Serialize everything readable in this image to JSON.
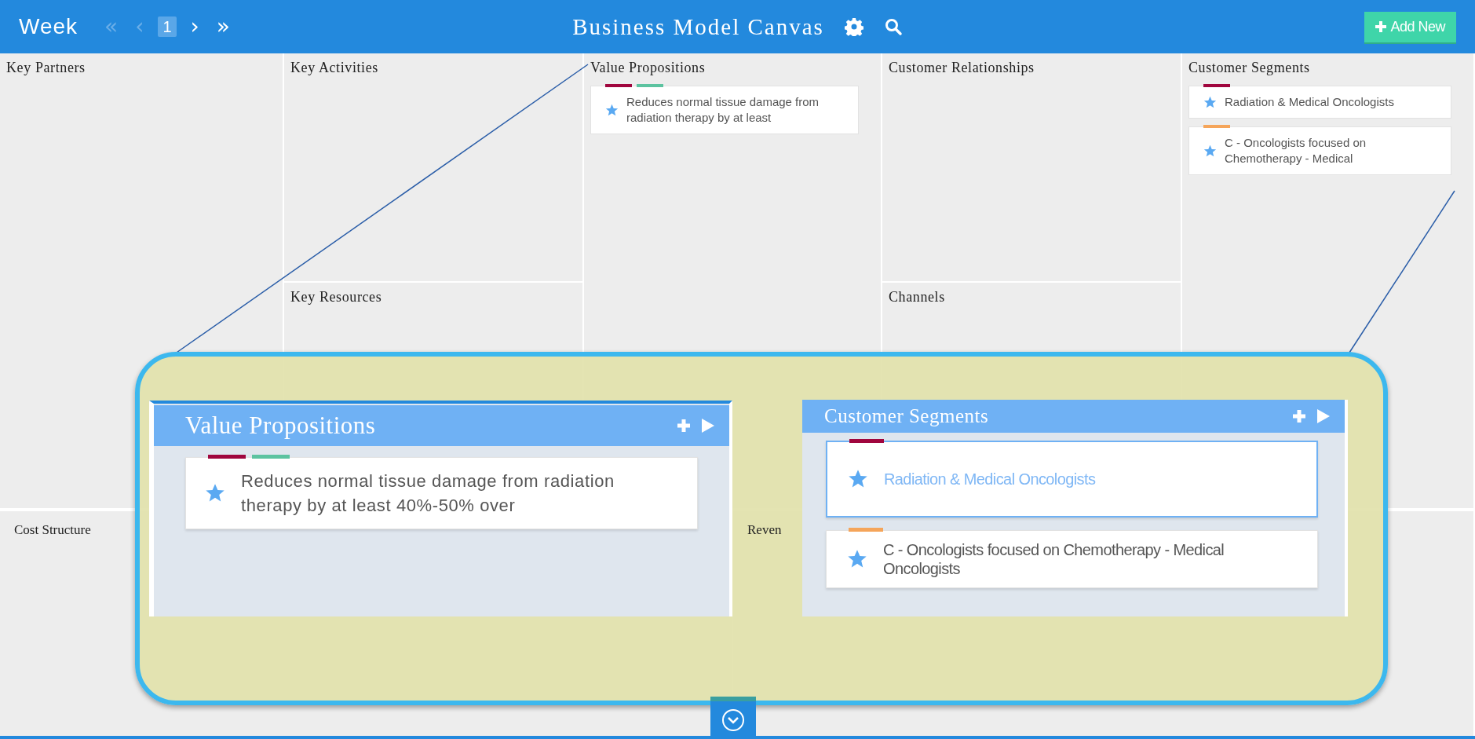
{
  "header": {
    "period_label": "Week",
    "pager": [
      {
        "label": "«",
        "disabled": true
      },
      {
        "label": "‹",
        "disabled": true
      },
      {
        "label": "1",
        "current": true
      },
      {
        "label": "›",
        "disabled": false
      },
      {
        "label": "»",
        "disabled": false
      }
    ],
    "title": "Business Model Canvas",
    "add_button": "Add New"
  },
  "canvas": {
    "blocks": [
      {
        "title": "Key Partners"
      },
      {
        "title": "Key Activities"
      },
      {
        "title": "Value Propositions",
        "cards": [
          {
            "text": "Reduces normal tissue damage from radiation therapy by at least",
            "tags": [
              {
                "color": "#a0063e"
              },
              {
                "color": "#5cc3a0"
              }
            ]
          }
        ]
      },
      {
        "title": "Customer Relationships"
      },
      {
        "title": "Customer Segments",
        "cards": [
          {
            "text": "Radiation & Medical Oncologists",
            "tags": [
              {
                "color": "#a0063e"
              }
            ]
          },
          {
            "text": "C - Oncologists focused on Chemotherapy - Medical",
            "tags": [
              {
                "color": "#f5a55a"
              }
            ]
          }
        ]
      },
      {
        "title": "Key Resources"
      },
      {
        "title": "Channels"
      }
    ],
    "bottom_blocks": [
      {
        "title": "Cost Structure"
      },
      {
        "title": "Reven"
      }
    ]
  },
  "zoom_callout": {
    "panels": [
      {
        "title": "Value Propositions",
        "cards": [
          {
            "text": "Reduces normal tissue damage from radiation therapy by at least 40%-50% over",
            "selected": false,
            "tags": [
              {
                "color": "#a0063e"
              },
              {
                "color": "#5cc3a0"
              }
            ]
          }
        ]
      },
      {
        "title": "Customer Segments",
        "cards": [
          {
            "text": "Radiation & Medical Oncologists",
            "selected": true,
            "tags": [
              {
                "color": "#a0063e"
              }
            ]
          },
          {
            "text": "C - Oncologists focused on Chemotherapy - Medical Oncologists",
            "selected": false,
            "tags": [
              {
                "color": "#f5a55a"
              }
            ]
          }
        ]
      }
    ]
  }
}
